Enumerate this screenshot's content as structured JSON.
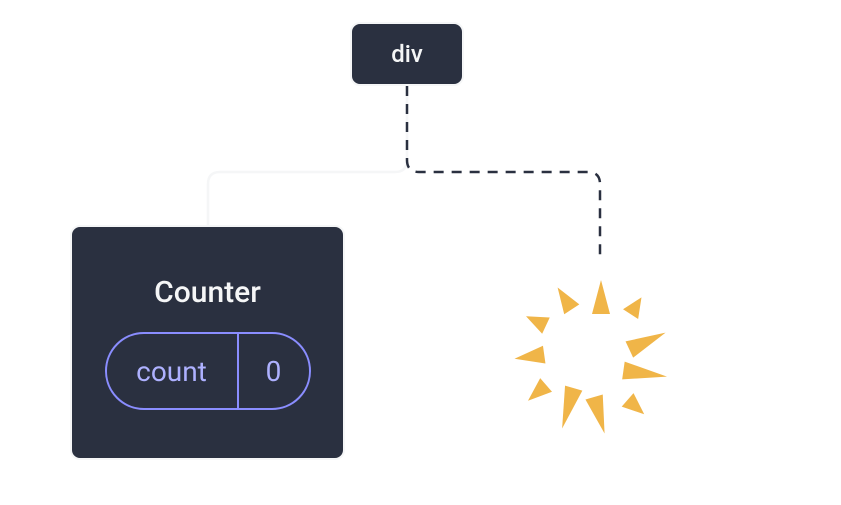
{
  "root": {
    "label": "div"
  },
  "counter": {
    "title": "Counter",
    "state_label": "count",
    "state_value": "0"
  },
  "colors": {
    "node_bg": "#2a3040",
    "node_border": "#f5f6f7",
    "pill_border": "#8a8dff",
    "pill_text": "#aeb1ff",
    "burst": "#f0b548"
  }
}
